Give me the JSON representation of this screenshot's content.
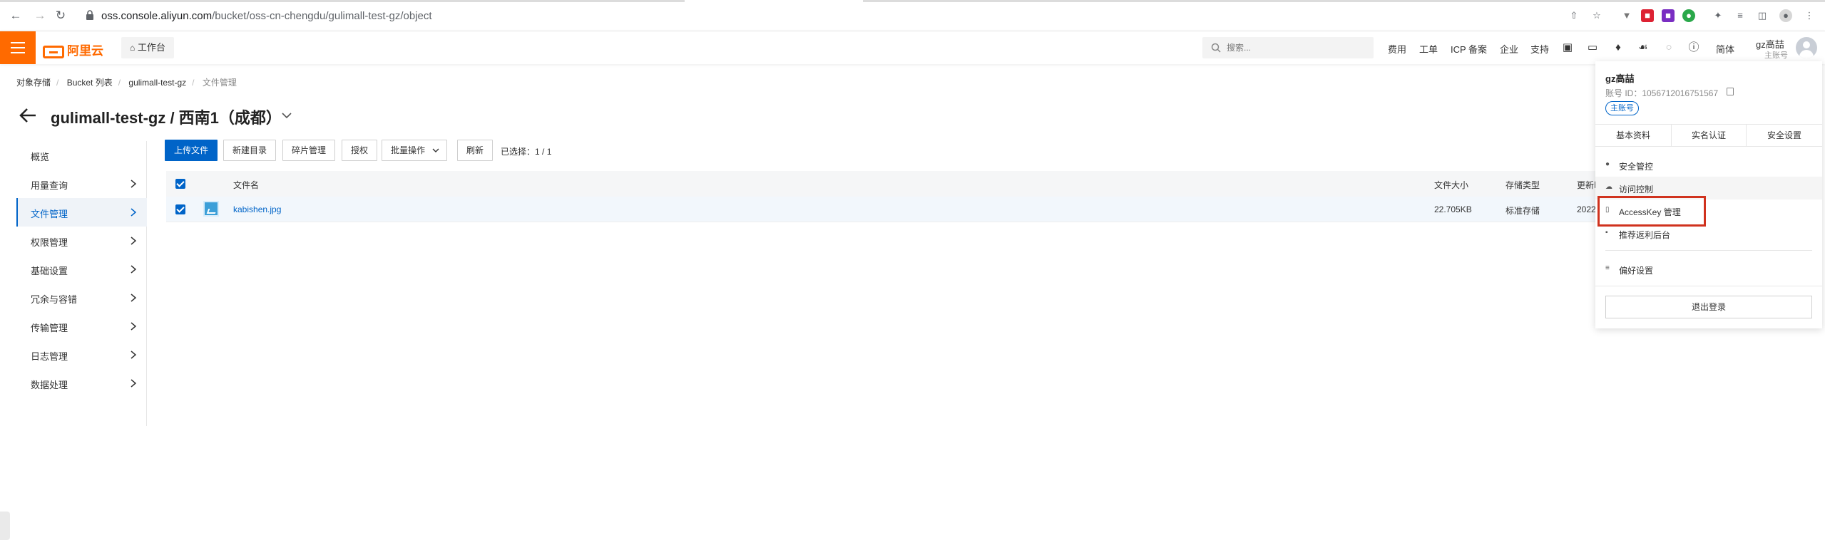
{
  "browser": {
    "url_host": "oss.console.aliyun.com",
    "url_path": "/bucket/oss-cn-chengdu/gulimall-test-gz/object"
  },
  "header": {
    "logo_text": "阿里云",
    "workbench": "工作台",
    "search_placeholder": "搜索...",
    "links": [
      "费用",
      "工单",
      "ICP 备案",
      "企业",
      "支持"
    ],
    "lang": "简体",
    "user_name": "gz高喆",
    "user_role": "主账号"
  },
  "breadcrumb": [
    "对象存储",
    "Bucket 列表",
    "gulimall-test-gz",
    "文件管理"
  ],
  "page": {
    "title": "gulimall-test-gz / 西南1（成都）"
  },
  "sidebar": {
    "items": [
      {
        "label": "概览"
      },
      {
        "label": "用量查询"
      },
      {
        "label": "文件管理"
      },
      {
        "label": "权限管理"
      },
      {
        "label": "基础设置"
      },
      {
        "label": "冗余与容错"
      },
      {
        "label": "传输管理"
      },
      {
        "label": "日志管理"
      },
      {
        "label": "数据处理"
      }
    ]
  },
  "toolbar": {
    "upload": "上传文件",
    "new_dir": "新建目录",
    "fragments": "碎片管理",
    "authorize": "授权",
    "batch": "批量操作",
    "refresh": "刷新",
    "selected_label": "已选择：",
    "selected_value": "1 / 1"
  },
  "table": {
    "headers": {
      "name": "文件名",
      "size": "文件大小",
      "storage": "存储类型",
      "updated": "更新时"
    },
    "rows": [
      {
        "name": "kabishen.jpg",
        "size": "22.705KB",
        "storage": "标准存储",
        "updated": "2022"
      }
    ]
  },
  "panel": {
    "name": "gz高喆",
    "account_id": "账号 ID：1056712016751567",
    "badge": "主账号",
    "tabs": [
      "基本资料",
      "实名认证",
      "安全设置"
    ],
    "items": [
      "安全管控",
      "访问控制",
      "AccessKey 管理",
      "推荐返利后台"
    ],
    "preferences": "偏好设置",
    "logout": "退出登录"
  },
  "colors": {
    "brand": "#ff6a00",
    "primary": "#0064c8",
    "highlight": "#d0321e"
  }
}
